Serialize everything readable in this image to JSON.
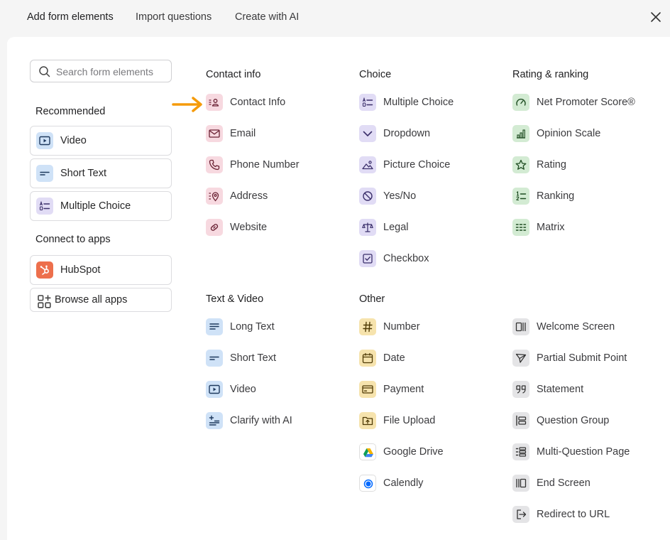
{
  "tabs": {
    "add_form_elements": "Add form elements",
    "import_questions": "Import questions",
    "create_with_ai": "Create with AI"
  },
  "search": {
    "placeholder": "Search form elements"
  },
  "sidebar": {
    "recommended_heading": "Recommended",
    "recommended": [
      {
        "label": "Video",
        "icon": "video-icon"
      },
      {
        "label": "Short Text",
        "icon": "short-text-icon"
      },
      {
        "label": "Multiple Choice",
        "icon": "multiple-choice-icon"
      }
    ],
    "connect_heading": "Connect to apps",
    "apps": [
      {
        "label": "HubSpot",
        "icon": "hubspot-icon"
      },
      {
        "label": "Browse all apps",
        "icon": "apps-grid-icon"
      }
    ]
  },
  "sections": {
    "contact_info": {
      "heading": "Contact info",
      "items": [
        {
          "label": "Contact Info",
          "icon": "contact-card-icon"
        },
        {
          "label": "Email",
          "icon": "envelope-icon"
        },
        {
          "label": "Phone Number",
          "icon": "phone-icon"
        },
        {
          "label": "Address",
          "icon": "location-pin-icon"
        },
        {
          "label": "Website",
          "icon": "link-icon"
        }
      ]
    },
    "choice": {
      "heading": "Choice",
      "items": [
        {
          "label": "Multiple Choice",
          "icon": "multiple-choice-icon"
        },
        {
          "label": "Dropdown",
          "icon": "chevron-down-icon"
        },
        {
          "label": "Picture Choice",
          "icon": "picture-icon"
        },
        {
          "label": "Yes/No",
          "icon": "yes-no-icon"
        },
        {
          "label": "Legal",
          "icon": "scales-icon"
        },
        {
          "label": "Checkbox",
          "icon": "checkbox-icon"
        }
      ]
    },
    "rating_ranking": {
      "heading": "Rating & ranking",
      "items": [
        {
          "label": "Net Promoter Score®",
          "icon": "gauge-icon"
        },
        {
          "label": "Opinion Scale",
          "icon": "bar-scale-icon"
        },
        {
          "label": "Rating",
          "icon": "star-icon"
        },
        {
          "label": "Ranking",
          "icon": "ranking-icon"
        },
        {
          "label": "Matrix",
          "icon": "matrix-icon"
        }
      ]
    },
    "text_video": {
      "heading": "Text & Video",
      "items": [
        {
          "label": "Long Text",
          "icon": "long-text-icon"
        },
        {
          "label": "Short Text",
          "icon": "short-text-icon"
        },
        {
          "label": "Video",
          "icon": "video-icon"
        },
        {
          "label": "Clarify with AI",
          "icon": "clarify-ai-icon"
        }
      ]
    },
    "other": {
      "heading": "Other",
      "items": [
        {
          "label": "Number",
          "icon": "hash-icon"
        },
        {
          "label": "Date",
          "icon": "calendar-icon"
        },
        {
          "label": "Payment",
          "icon": "credit-card-icon"
        },
        {
          "label": "File Upload",
          "icon": "upload-icon"
        },
        {
          "label": "Google Drive",
          "icon": "google-drive-icon"
        },
        {
          "label": "Calendly",
          "icon": "calendly-icon"
        }
      ]
    },
    "other_screens": {
      "items": [
        {
          "label": "Welcome Screen",
          "icon": "welcome-screen-icon"
        },
        {
          "label": "Partial Submit Point",
          "icon": "send-icon"
        },
        {
          "label": "Statement",
          "icon": "quote-icon"
        },
        {
          "label": "Question Group",
          "icon": "question-group-icon"
        },
        {
          "label": "Multi-Question Page",
          "icon": "multi-question-icon"
        },
        {
          "label": "End Screen",
          "icon": "end-screen-icon"
        },
        {
          "label": "Redirect to URL",
          "icon": "redirect-icon"
        }
      ]
    }
  },
  "colors": {
    "contact": "#f7d9e0",
    "choice": "#e1dcf5",
    "rating": "#d3ebd3",
    "text_video": "#cfe2f7",
    "other": "#f6e3ad",
    "screens": "#e4e4e6",
    "hubspot": "#ed6f4c",
    "highlight_arrow": "#f59b0b"
  }
}
